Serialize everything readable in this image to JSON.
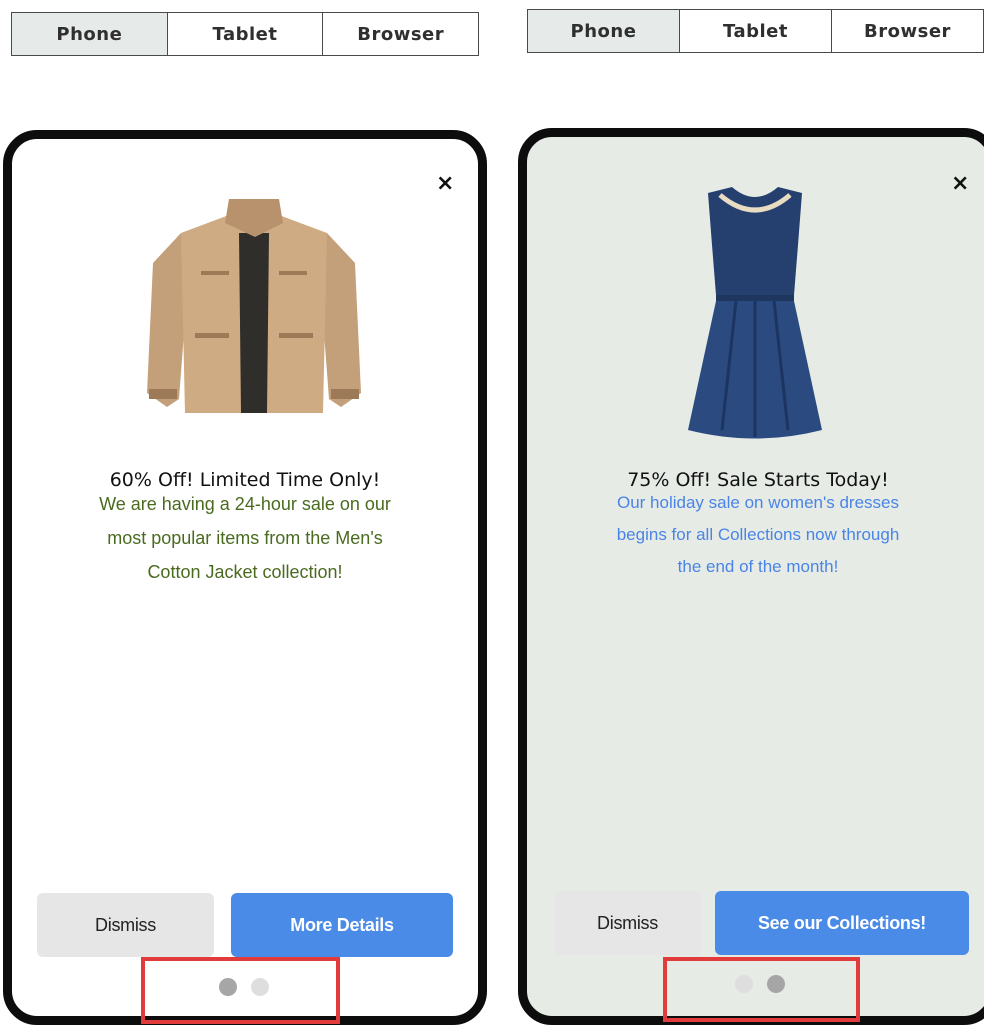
{
  "left": {
    "tabs": [
      {
        "label": "Phone",
        "active": true
      },
      {
        "label": "Tablet",
        "active": false
      },
      {
        "label": "Browser",
        "active": false
      }
    ],
    "close_label": "×",
    "headline": "60% Off! Limited Time Only!",
    "body_lines": [
      "We are having a 24-hour sale on our",
      "most popular items from the Men's",
      "Cotton Jacket collection!"
    ],
    "body_color": "#4a6b1f",
    "background": "#ffffff",
    "dismiss_label": "Dismiss",
    "primary_label": "More Details",
    "active_dot": 0
  },
  "right": {
    "tabs": [
      {
        "label": "Phone",
        "active": true
      },
      {
        "label": "Tablet",
        "active": false
      },
      {
        "label": "Browser",
        "active": false
      }
    ],
    "close_label": "×",
    "headline": "75% Off! Sale Starts Today!",
    "body_lines": [
      "Our holiday sale on women's dresses",
      "begins for all Collections now through",
      "the end of the month!"
    ],
    "body_color": "#4a84e6",
    "background": "#e6ebe6",
    "dismiss_label": "Dismiss",
    "primary_label": "See our Collections!",
    "active_dot": 1
  },
  "colors": {
    "accent": "#4a8be8",
    "highlight": "#e23b3b",
    "dot_active": "#a6a6a6",
    "dot_inactive": "#dedede"
  }
}
